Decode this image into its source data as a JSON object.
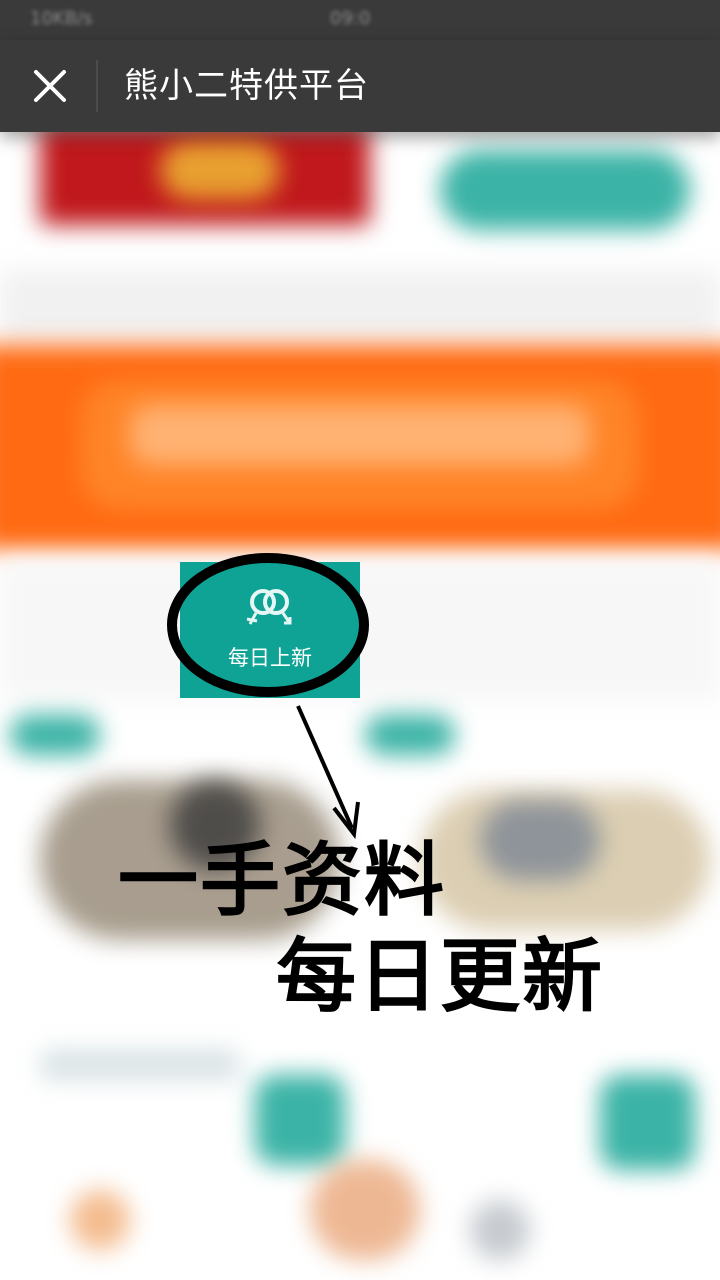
{
  "status_bar": {
    "left_text": "10KB/s",
    "time": "09:0"
  },
  "title_bar": {
    "close_icon": "close-icon",
    "title": "熊小二特供平台"
  },
  "highlight_tile": {
    "icon": "gender-rings-icon",
    "label": "每日上新",
    "bg_color": "#0fa396"
  },
  "annotation": {
    "line1": "一手资料",
    "line2": "每日更新",
    "circle_color": "#000000",
    "text_color": "#000000"
  },
  "colors": {
    "title_bar": "#3a3a3a",
    "accent_teal": "#3bb3a6",
    "banner_orange": "#ff6a12"
  }
}
